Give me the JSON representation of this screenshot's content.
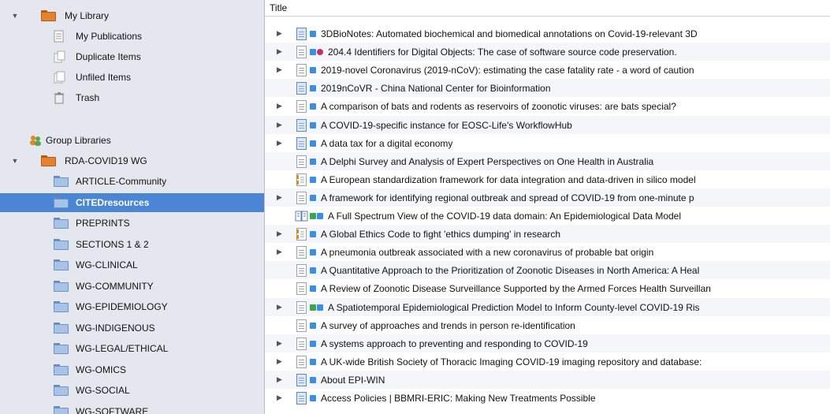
{
  "sidebar": {
    "my_library": {
      "label": "My Library"
    },
    "library_items": [
      {
        "label": "My Publications",
        "icon": "publications-icon"
      },
      {
        "label": "Duplicate Items",
        "icon": "duplicate-icon"
      },
      {
        "label": "Unfiled Items",
        "icon": "unfiled-icon"
      },
      {
        "label": "Trash",
        "icon": "trash-icon"
      }
    ],
    "group_libraries": {
      "label": "Group Libraries"
    },
    "group": {
      "label": "RDA-COVID19 WG"
    },
    "collections": [
      {
        "label": "ARTICLE-Community"
      },
      {
        "label": "CITEDresources",
        "selected": true
      },
      {
        "label": "PREPRINTS"
      },
      {
        "label": "SECTIONS 1 & 2"
      },
      {
        "label": "WG-CLINICAL"
      },
      {
        "label": "WG-COMMUNITY"
      },
      {
        "label": "WG-EPIDEMIOLOGY"
      },
      {
        "label": "WG-INDIGENOUS"
      },
      {
        "label": "WG-LEGAL/ETHICAL"
      },
      {
        "label": "WG-OMICS"
      },
      {
        "label": "WG-SOCIAL"
      },
      {
        "label": "WG-SOFTWARE"
      }
    ],
    "selected_color": "#4a86d4"
  },
  "main": {
    "column_header": "Title",
    "rows": [
      {
        "title": "3DBioNotes: Automated biochemical and biomedical annotations on Covid-19-relevant 3D",
        "expand": true,
        "icon": "doc-blue",
        "tags": [
          "#3a8ee6"
        ]
      },
      {
        "title": "204.4 Identifiers for Digital Objects: The case of software source code preservation.",
        "expand": true,
        "icon": "doc",
        "tags": [
          "#3a8ee6",
          "#c0306a"
        ]
      },
      {
        "title": "2019-novel Coronavirus (2019-nCoV): estimating the case fatality rate - a word of caution",
        "expand": true,
        "icon": "doc",
        "tags": [
          "#3a8ee6"
        ]
      },
      {
        "title": "2019nCoVR - China National Center for Bioinformation",
        "expand": false,
        "icon": "doc-blue",
        "tags": [
          "#3a8ee6"
        ]
      },
      {
        "title": "A comparison of bats and rodents as reservoirs of zoonotic viruses: are bats special?",
        "expand": true,
        "icon": "doc",
        "tags": [
          "#3a8ee6"
        ]
      },
      {
        "title": "A COVID-19-specific instance for EOSC-Life's WorkflowHub",
        "expand": true,
        "icon": "doc-blue",
        "tags": [
          "#3a8ee6"
        ]
      },
      {
        "title": "A data tax for a digital economy",
        "expand": true,
        "icon": "doc-blue",
        "tags": [
          "#3a8ee6"
        ]
      },
      {
        "title": "A Delphi Survey and Analysis of Expert Perspectives on One Health in Australia",
        "expand": false,
        "icon": "doc",
        "tags": [
          "#3a8ee6"
        ]
      },
      {
        "title": "A European standardization framework for data integration and data-driven in silico model",
        "expand": false,
        "icon": "report",
        "tags": [
          "#3a8ee6"
        ]
      },
      {
        "title": "A framework for identifying regional outbreak and spread of COVID-19 from one-minute p",
        "expand": true,
        "icon": "doc",
        "tags": [
          "#3a8ee6"
        ]
      },
      {
        "title": "A Full Spectrum View of the COVID-19 data domain: An Epidemiological Data Model",
        "expand": false,
        "icon": "book",
        "tags": [
          "#3aa84a",
          "#3a8ee6"
        ]
      },
      {
        "title": "A Global Ethics Code to fight 'ethics dumping' in research",
        "expand": true,
        "icon": "report",
        "tags": [
          "#3a8ee6"
        ]
      },
      {
        "title": "A pneumonia outbreak associated with a new coronavirus of probable bat origin",
        "expand": true,
        "icon": "doc",
        "tags": [
          "#3a8ee6"
        ]
      },
      {
        "title": "A Quantitative Approach to the Prioritization of Zoonotic Diseases in North America: A Heal",
        "expand": false,
        "icon": "doc",
        "tags": [
          "#3a8ee6"
        ]
      },
      {
        "title": "A Review of Zoonotic Disease Surveillance Supported by the Armed Forces Health Surveillan",
        "expand": false,
        "icon": "doc",
        "tags": [
          "#3a8ee6"
        ]
      },
      {
        "title": "A Spatiotemporal Epidemiological Prediction Model to Inform County-level COVID-19 Ris",
        "expand": true,
        "icon": "doc",
        "tags": [
          "#3aa84a",
          "#3a8ee6"
        ]
      },
      {
        "title": "A survey of approaches and trends in person re-identification",
        "expand": false,
        "icon": "doc",
        "tags": [
          "#3a8ee6"
        ]
      },
      {
        "title": "A systems approach to preventing and responding to COVID-19",
        "expand": true,
        "icon": "doc",
        "tags": [
          "#3a8ee6"
        ]
      },
      {
        "title": "A UK-wide British Society of Thoracic Imaging COVID-19 imaging repository and database:",
        "expand": true,
        "icon": "doc",
        "tags": [
          "#3a8ee6"
        ]
      },
      {
        "title": "About EPI-WIN",
        "expand": true,
        "icon": "doc-blue",
        "tags": [
          "#3a8ee6"
        ]
      },
      {
        "title": "Access Policies | BBMRI-ERIC: Making New Treatments Possible",
        "expand": true,
        "icon": "doc-blue",
        "tags": [
          "#3a8ee6"
        ]
      }
    ]
  }
}
